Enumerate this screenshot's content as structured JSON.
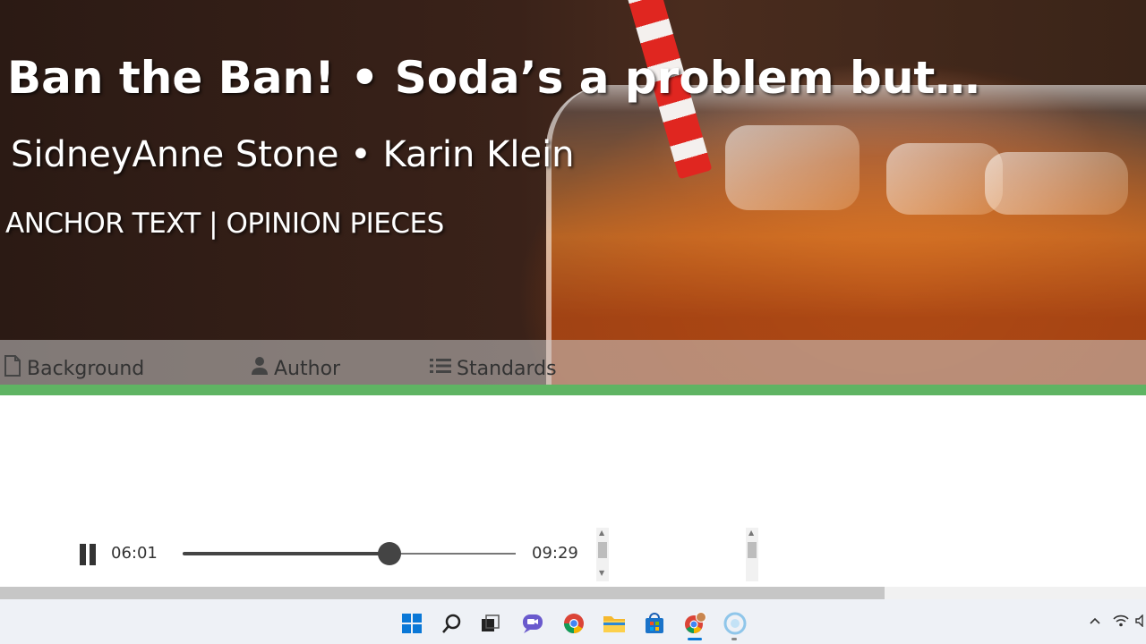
{
  "header": {
    "title": "Ban the Ban! • Soda’s a problem but…",
    "authors": "SidneyAnne Stone • Karin Klein",
    "kicker": "ANCHOR TEXT | OPINION PIECES"
  },
  "tabs": [
    {
      "label": "Background",
      "icon": "document-icon"
    },
    {
      "label": "Author",
      "icon": "person-icon"
    },
    {
      "label": "Standards",
      "icon": "list-icon"
    }
  ],
  "player": {
    "state_icon": "pause-icon",
    "current_time": "06:01",
    "duration": "09:29",
    "progress": 0.621
  },
  "taskbar": {
    "icons": [
      "windows-start-icon",
      "search-icon",
      "task-view-icon",
      "chat-icon",
      "chrome-icon",
      "file-explorer-icon",
      "store-icon",
      "chrome-profile-icon",
      "cortana-icon"
    ],
    "tray": [
      "chevron-up-icon",
      "wifi-icon",
      "speaker-icon"
    ]
  },
  "colors": {
    "accent_bar": "#5fb463",
    "tab_bar": "#c8c8c8",
    "slider": "#444444"
  }
}
